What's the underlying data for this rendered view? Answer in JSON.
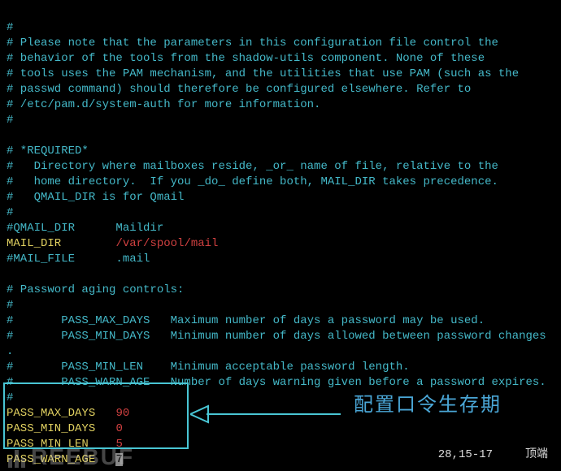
{
  "lines": {
    "l0": "#",
    "l1": "# Please note that the parameters in this configuration file control the",
    "l2": "# behavior of the tools from the shadow-utils component. None of these",
    "l3": "# tools uses the PAM mechanism, and the utilities that use PAM (such as the",
    "l4": "# passwd command) should therefore be configured elsewhere. Refer to",
    "l5": "# /etc/pam.d/system-auth for more information.",
    "l6": "#",
    "l7": "",
    "l8": "# *REQUIRED*",
    "l9": "#   Directory where mailboxes reside, _or_ name of file, relative to the",
    "l10": "#   home directory.  If you _do_ define both, MAIL_DIR takes precedence.",
    "l11": "#   QMAIL_DIR is for Qmail",
    "l12": "#",
    "l13": "#QMAIL_DIR      Maildir",
    "mail_key": "MAIL_DIR",
    "mail_pad": "        ",
    "mail_val": "/var/spool/mail",
    "l15": "#MAIL_FILE      .mail",
    "l16": "",
    "l17": "# Password aging controls:",
    "l18": "#",
    "l19": "#       PASS_MAX_DAYS   Maximum number of days a password may be used.",
    "l20": "#       PASS_MIN_DAYS   Minimum number of days allowed between password changes",
    "l20b": ".",
    "l21": "#       PASS_MIN_LEN    Minimum acceptable password length.",
    "l22": "#       PASS_WARN_AGE   Number of days warning given before a password expires.",
    "l23": "#",
    "pmax_k": "PASS_MAX_DAYS",
    "pmax_p": "   ",
    "pmax_v": "90",
    "pmin_k": "PASS_MIN_DAYS",
    "pmin_p": "   ",
    "pmin_v": "0",
    "plen_k": "PASS_MIN_LEN",
    "plen_p": "    ",
    "plen_v": "5",
    "pwarn_k": "PASS_WARN_AGE",
    "pwarn_p": "   ",
    "pwarn_v": "7"
  },
  "annotation": "配置口令生存期",
  "status": {
    "position": "28,15-17",
    "label": "顶端"
  },
  "watermark": "REEBUF"
}
